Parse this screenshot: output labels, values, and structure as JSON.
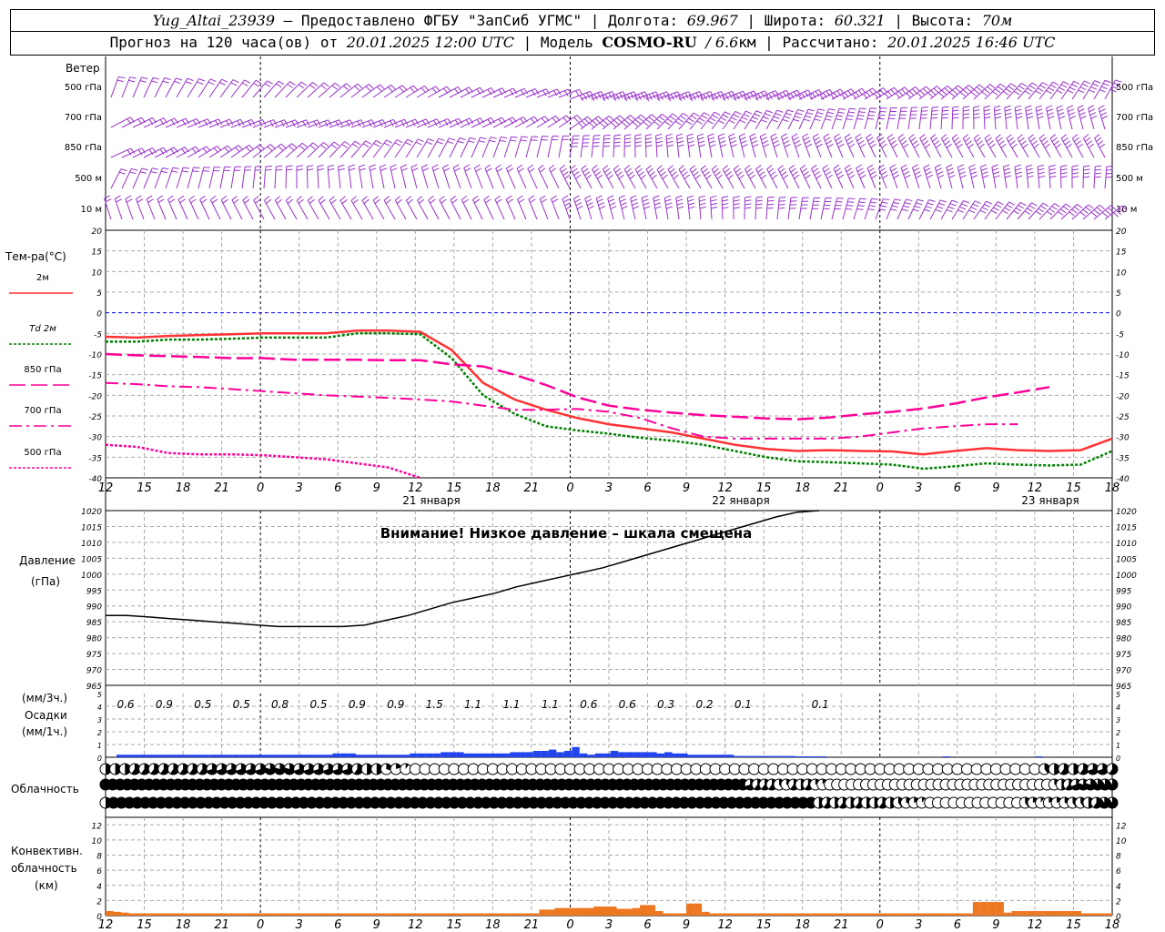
{
  "header": {
    "station": "Yug_Altai_23939",
    "provider": "– Предоставлено ФГБУ \"ЗапСиб УГМС\"",
    "lon_label": "Долгота:",
    "lon": "69.967",
    "lat_label": "Широта:",
    "lat": "60.321",
    "alt_label": "Высота:",
    "alt": "70м",
    "forecast_prefix": "Прогноз на 120 часа(ов) от",
    "forecast_time": "20.01.2025 12:00 UTC",
    "model_label": "Модель",
    "model": "COSMO-RU",
    "resolution": "/ 6.6",
    "resolution_unit": "км",
    "calc_label": "Рассчитано:",
    "calc_time": "20.01.2025 16:46 UTC"
  },
  "labels": {
    "wind": "Ветер",
    "temp": "Тем-ра(°С)",
    "td": "Td",
    "pressure1": "Давление",
    "pressure2": "(гПа)",
    "precip1": "(мм/3ч.)",
    "precip2": "Осадки",
    "precip3": "(мм/1ч.)",
    "cloud": "Облачность",
    "conv1": "Конвективн.",
    "conv2": "облачность",
    "conv3": "(км)",
    "pressure_warning": "Внимание! Низкое давление – шкала смещена"
  },
  "colors": {
    "wind": "#9933cc",
    "t2m": "#ff3333",
    "td2m": "#008000",
    "t_upper": "#ff0099",
    "precip": "#2244ee",
    "conv": "#ee7722",
    "zero_line": "#0000ff"
  },
  "chart_data": [
    {
      "type": "wind_barbs",
      "levels": [
        "500 гПа",
        "700 гПа",
        "850 гПа",
        "500 м",
        "10  м"
      ],
      "note": "wind barbs per level over 120 h forecast"
    },
    {
      "type": "line",
      "title": "Тем-ра(°С)",
      "x_ticks": [
        "12",
        "15",
        "18",
        "21",
        "0",
        "3",
        "6",
        "9",
        "12",
        "15",
        "18",
        "21",
        "0",
        "3",
        "6",
        "9",
        "12",
        "15",
        "18",
        "21",
        "0",
        "3",
        "6",
        "9",
        "12",
        "15",
        "18"
      ],
      "date_labels": [
        "21 января",
        "22 января",
        "23 января"
      ],
      "ylim": [
        -40,
        20
      ],
      "yticks": [
        20,
        15,
        10,
        5,
        0,
        -5,
        -10,
        -15,
        -20,
        -25,
        -30,
        -35,
        -40
      ],
      "series": [
        {
          "name": "2м",
          "style": "solid",
          "values": [
            -5.8,
            -6,
            -5.6,
            -5.4,
            -5.2,
            -5,
            -5,
            -5,
            -4.3,
            -4.3,
            -4.6,
            -9,
            -17,
            -21,
            -23.5,
            -25.5,
            -27,
            -28,
            -29,
            -30.5,
            -32,
            -33,
            -33.5,
            -33.3,
            -33.5,
            -33.6,
            -34.3,
            -33.5,
            -32.8,
            -33.3,
            -33.5,
            -33.3,
            -30.5
          ]
        },
        {
          "name": "Td 2м",
          "style": "dotted",
          "values": [
            -7,
            -7,
            -6.5,
            -6.5,
            -6.3,
            -6,
            -6,
            -6,
            -5,
            -5,
            -5.2,
            -11,
            -20,
            -24.5,
            -27.5,
            -28.5,
            -29.3,
            -30.3,
            -31,
            -32,
            -33.5,
            -35,
            -36,
            -36.2,
            -36.5,
            -36.8,
            -37.8,
            -37.2,
            -36.5,
            -36.8,
            -37,
            -36.8,
            -33.5
          ]
        },
        {
          "name": "850 гПа",
          "style": "dash",
          "values": [
            -10,
            -10.3,
            -10.5,
            -10.7,
            -11,
            -11,
            -11.4,
            -11.4,
            -11.4,
            -11.5,
            -11.5,
            -12.5,
            -13,
            -15,
            -17.5,
            -20.5,
            -22.5,
            -23.5,
            -24.2,
            -24.8,
            -25.2,
            -25.6,
            -25.8,
            -25.4,
            -24.6,
            -24,
            -23.2,
            -22,
            -20.5,
            -19.3,
            -18
          ]
        },
        {
          "name": "700 гПа",
          "style": "dashdot",
          "values": [
            -17,
            -17.3,
            -17.8,
            -18,
            -18.5,
            -19,
            -19.5,
            -20,
            -20.3,
            -20.6,
            -21,
            -21.5,
            -22.5,
            -23.5,
            -23.5,
            -23.3,
            -24,
            -25.5,
            -28,
            -30,
            -30.5,
            -30.5,
            -30.5,
            -30.5,
            -30,
            -29,
            -28,
            -27.5,
            -27,
            -27
          ]
        },
        {
          "name": "500 гПа",
          "style": "dotted",
          "values": [
            -32,
            -32.5,
            -34,
            -34.3,
            -34.3,
            -34.5,
            -35,
            -35.5,
            -36.5,
            -37.5,
            -40
          ]
        }
      ]
    },
    {
      "type": "line",
      "title": "Давление (гПа)",
      "ylim": [
        965,
        1020
      ],
      "yticks": [
        1020,
        1015,
        1010,
        1005,
        1000,
        995,
        990,
        985,
        980,
        975,
        970,
        965
      ],
      "series": [
        {
          "name": "Давление",
          "values": [
            987,
            987,
            986.5,
            986,
            985.5,
            985,
            984.5,
            984,
            983.5,
            983.5,
            983.5,
            983.5,
            984,
            985.5,
            987,
            989,
            991,
            992.5,
            994,
            996,
            997.5,
            999,
            1000.5,
            1002,
            1004,
            1006,
            1008,
            1010,
            1012,
            1014,
            1016,
            1018,
            1019.5,
            1020
          ]
        }
      ]
    },
    {
      "type": "bar",
      "title": "Осадки",
      "sums_3h": [
        "0.6",
        "0.9",
        "0.5",
        "0.5",
        "0.8",
        "0.5",
        "0.9",
        "0.9",
        "1.5",
        "1.1",
        "1.1",
        "1.1",
        "0.6",
        "0.6",
        "0.3",
        "0.2",
        "0.1",
        "",
        "0.1"
      ],
      "ylim": [
        0,
        5
      ],
      "hourly_values": [
        0.2,
        0.2,
        0.2,
        0.2,
        0.2,
        0.2,
        0.2,
        0.2,
        0.2,
        0.2,
        0.2,
        0.2,
        0.2,
        0.2,
        0.2,
        0.2,
        0.2,
        0.2,
        0.2,
        0.2,
        0.2,
        0.2,
        0.2,
        0.2,
        0.2,
        0.2,
        0.2,
        0.2,
        0.3,
        0.3,
        0.3,
        0.2,
        0.2,
        0.2,
        0.2,
        0.2,
        0.2,
        0.2,
        0.3,
        0.3,
        0.3,
        0.3,
        0.4,
        0.4,
        0.4,
        0.3,
        0.3,
        0.3,
        0.3,
        0.3,
        0.3,
        0.4,
        0.4,
        0.4,
        0.5,
        0.5,
        0.6,
        0.4,
        0.5,
        0.8,
        0.3,
        0.2,
        0.3,
        0.3,
        0.5,
        0.4,
        0.4,
        0.4,
        0.4,
        0.4,
        0.3,
        0.4,
        0.3,
        0.3,
        0.2,
        0.2,
        0.2,
        0.2,
        0.2,
        0.2,
        0.1,
        0.1,
        0.1,
        0.1,
        0.1,
        0.1,
        0.1,
        0.1,
        0.05,
        0.05,
        0.05,
        0.02,
        0,
        0,
        0,
        0,
        0,
        0,
        0,
        0,
        0,
        0,
        0,
        0,
        0,
        0,
        0,
        0.03,
        0,
        0,
        0,
        0,
        0,
        0,
        0,
        0,
        0,
        0,
        0,
        0.05
      ]
    },
    {
      "type": "cloud_cover",
      "title": "Облачность",
      "rows": [
        {
          "name": "top",
          "values": [
            0.5,
            0.5,
            0.5,
            0.6,
            0.6,
            0.6,
            0.6,
            0.6,
            0.6,
            0.6,
            0.6,
            0.7,
            0.7,
            0.7,
            0.7,
            0.7,
            0.7,
            0.8,
            0.8,
            0.8,
            0.7,
            0.7,
            0.7,
            0.7,
            0.7,
            0.7,
            0.6,
            0.5,
            0.5,
            0.3,
            0.2,
            0.1,
            0,
            0,
            0,
            0,
            0,
            0,
            0,
            0,
            0,
            0,
            0,
            0,
            0,
            0,
            0,
            0,
            0,
            0,
            0,
            0,
            0,
            0,
            0,
            0,
            0,
            0,
            0,
            0,
            0,
            0,
            0,
            0,
            0,
            0,
            0,
            0,
            0,
            0,
            0,
            0,
            0,
            0,
            0,
            0,
            0,
            0,
            0,
            0,
            0,
            0,
            0,
            0,
            0,
            0,
            0,
            0,
            0,
            0,
            0,
            0,
            0,
            0,
            0,
            0,
            0,
            0.4,
            0.5,
            0.6,
            0.5,
            0.6,
            0.7,
            0.7,
            0.6
          ]
        },
        {
          "name": "middle",
          "values": [
            1,
            1,
            1,
            1,
            1,
            1,
            1,
            1,
            1,
            1,
            1,
            1,
            1,
            1,
            1,
            1,
            1,
            1,
            1,
            1,
            1,
            1,
            1,
            1,
            1,
            1,
            1,
            1,
            1,
            1,
            1,
            1,
            1,
            1,
            1,
            1,
            1,
            1,
            1,
            1,
            1,
            1,
            1,
            1,
            1,
            1,
            1,
            1,
            1,
            1,
            1,
            1,
            1,
            1,
            1,
            1,
            1,
            1,
            1,
            1,
            1,
            1,
            1,
            1,
            1,
            1,
            1,
            1,
            1,
            1,
            1,
            1,
            1,
            1,
            1,
            1,
            1,
            1,
            1,
            1,
            1,
            1,
            1,
            1,
            1,
            1,
            1,
            1,
            1,
            0.7,
            0.6,
            0.6,
            0.6,
            0.4,
            0.3,
            0.6,
            0.5,
            0.6,
            0.2,
            0.1,
            0,
            0,
            0,
            0,
            0,
            0,
            0,
            0,
            0,
            0,
            0,
            0,
            0,
            0,
            0,
            0,
            0,
            0,
            0,
            0,
            0,
            0,
            0,
            0,
            0,
            0,
            0,
            0,
            0,
            0,
            0,
            0.3,
            0.5,
            0.6,
            0.7,
            0.8,
            0.8,
            0.9,
            0.9,
            0.9
          ]
        },
        {
          "name": "low",
          "values": [
            0.5,
            1,
            1,
            1,
            1,
            1,
            1,
            1,
            1,
            1,
            1,
            1,
            1,
            1,
            1,
            1,
            1,
            1,
            1,
            1,
            1,
            1,
            1,
            1,
            1,
            1,
            1,
            1,
            1,
            1,
            1,
            1,
            1,
            1,
            1,
            1,
            1,
            1,
            1,
            1,
            1,
            1,
            1,
            1,
            1,
            1,
            1,
            1,
            1,
            1,
            1,
            1,
            1,
            1,
            1,
            1,
            1,
            1,
            1,
            1,
            1,
            1,
            1,
            1,
            1,
            1,
            1,
            1,
            1,
            1,
            1,
            1,
            1,
            1,
            1,
            1,
            1,
            1,
            1,
            1,
            1,
            1,
            1,
            1,
            1,
            1,
            1,
            1,
            1,
            1,
            0.5,
            0.6,
            0.5,
            0.6,
            0.5,
            0.6,
            0.5,
            0.5,
            0.6,
            0.5,
            0.4,
            0.3,
            0.2,
            0.1,
            0,
            0,
            0,
            0,
            0,
            0,
            0,
            0,
            0,
            0,
            0,
            0,
            0.4,
            0.2,
            0.1,
            0.2,
            0.2,
            0.3,
            0.4,
            0.4,
            0.5,
            0.6,
            0.9,
            0.9
          ]
        }
      ]
    },
    {
      "type": "bar",
      "title": "Конвективн. облачность (км)",
      "ylim": [
        0,
        13
      ],
      "yticks": [
        12,
        10,
        8,
        6,
        4,
        2,
        0
      ],
      "hourly_values": [
        0.6,
        0.5,
        0.4,
        0.3,
        0.3,
        0.3,
        0.3,
        0.3,
        0.3,
        0.3,
        0.3,
        0.3,
        0.3,
        0.3,
        0.3,
        0.3,
        0.3,
        0.3,
        0.3,
        0.3,
        0.3,
        0.3,
        0.3,
        0.3,
        0.3,
        0.3,
        0.3,
        0.3,
        0.3,
        0.3,
        0.3,
        0.3,
        0.3,
        0.3,
        0.3,
        0.3,
        0.3,
        0.3,
        0.3,
        0.3,
        0.3,
        0.3,
        0.3,
        0.3,
        0.3,
        0.3,
        0.3,
        0.3,
        0.3,
        0.3,
        0.3,
        0.3,
        0.3,
        0.3,
        0.3,
        0.3,
        0.8,
        0.8,
        1,
        1,
        1,
        1,
        1,
        1.2,
        1.2,
        1.2,
        0.9,
        0.9,
        1,
        1.4,
        1.4,
        0.6,
        0.3,
        0.3,
        0.3,
        1.6,
        1.6,
        0.5,
        0.3,
        0.3,
        0.3,
        0.3,
        0.3,
        0.3,
        0.3,
        0.3,
        0.3,
        0.3,
        0.3,
        0.3,
        0.3,
        0.3,
        0.3,
        0.3,
        0.3,
        0.3,
        0.3,
        0.3,
        0.3,
        0.3,
        0.3,
        0.3,
        0.3,
        0.3,
        0.3,
        0.3,
        0.3,
        0.3,
        0.3,
        0.3,
        0.3,
        0.3,
        1.8,
        1.8,
        1.8,
        1.8,
        0.4,
        0.6,
        0.6,
        0.6,
        0.6,
        0.6,
        0.6,
        0.6,
        0.6,
        0.6,
        0.3,
        0.3,
        0.3,
        0.3
      ]
    }
  ]
}
